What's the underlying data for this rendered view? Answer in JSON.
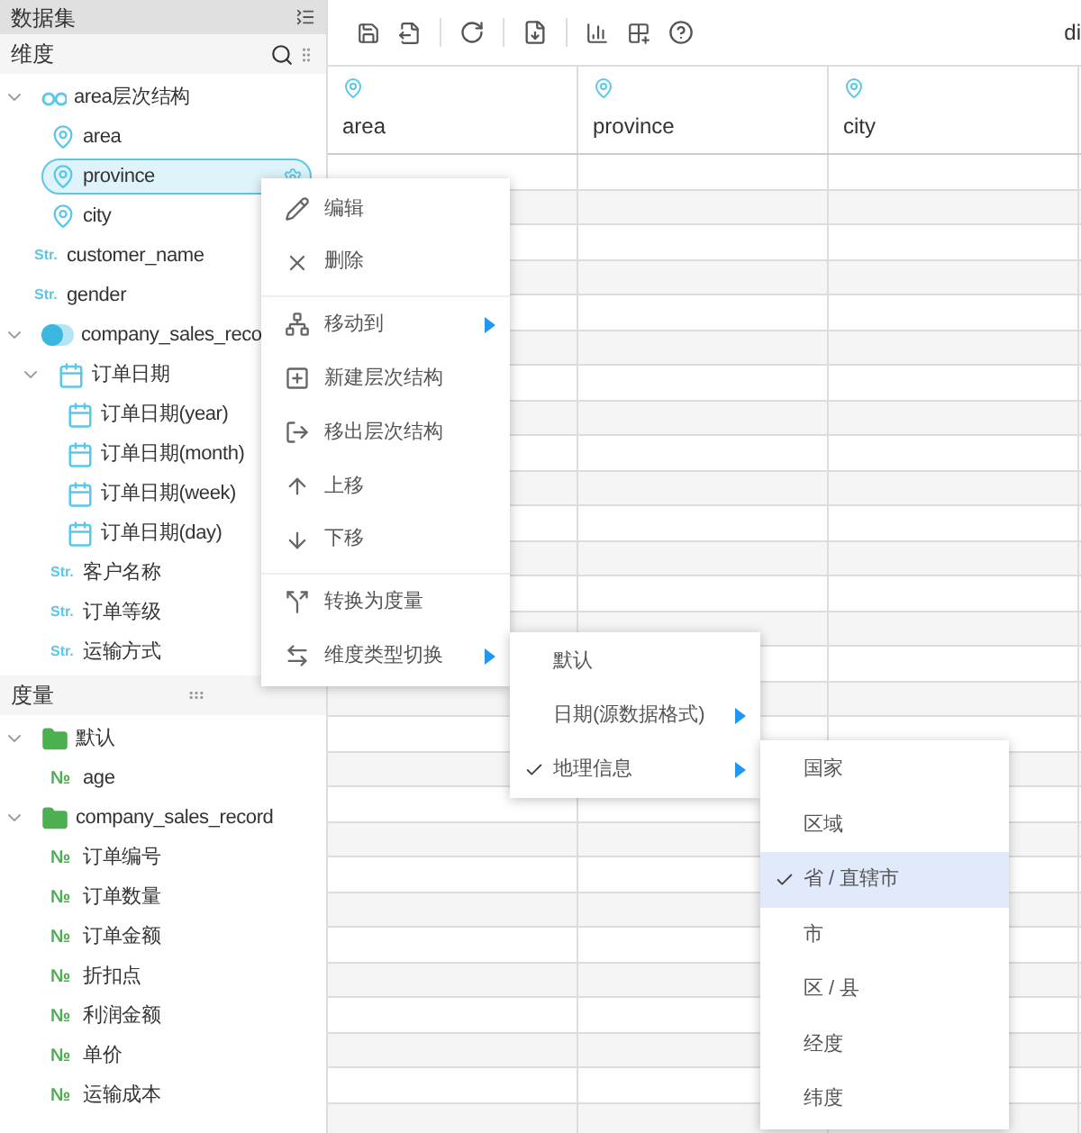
{
  "panel_title": "数据集",
  "dimensions": {
    "title": "维度",
    "items": [
      {
        "kind": "hierarchy",
        "label": "area层次结构",
        "selected": false,
        "expanded": true,
        "children": [
          {
            "kind": "geo",
            "label": "area",
            "selected": false
          },
          {
            "kind": "geo",
            "label": "province",
            "selected": true
          },
          {
            "kind": "geo",
            "label": "city",
            "selected": false
          }
        ]
      },
      {
        "kind": "text",
        "type_label": "Str.",
        "label": "customer_name",
        "selected": false
      },
      {
        "kind": "text",
        "type_label": "Str.",
        "label": "gender",
        "selected": false
      },
      {
        "kind": "dataset",
        "label": "company_sales_reco",
        "selected": false,
        "expanded": true,
        "children": [
          {
            "kind": "date",
            "label": "订单日期",
            "selected": false,
            "expanded": true,
            "children": [
              {
                "kind": "date",
                "label": "订单日期(year)",
                "selected": false
              },
              {
                "kind": "date",
                "label": "订单日期(month)",
                "selected": false
              },
              {
                "kind": "date",
                "label": "订单日期(week)",
                "selected": false
              },
              {
                "kind": "date",
                "label": "订单日期(day)",
                "selected": false
              }
            ]
          },
          {
            "kind": "text",
            "type_label": "Str.",
            "label": "客户名称",
            "selected": false
          },
          {
            "kind": "text",
            "type_label": "Str.",
            "label": "订单等级",
            "selected": false
          },
          {
            "kind": "text",
            "type_label": "Str.",
            "label": "运输方式",
            "selected": false
          }
        ]
      }
    ]
  },
  "measures": {
    "title": "度量",
    "items": [
      {
        "kind": "folder",
        "label": "默认",
        "selected": false,
        "expanded": true,
        "children": [
          {
            "kind": "number",
            "type_label": "№",
            "label": "age",
            "selected": false
          }
        ]
      },
      {
        "kind": "folder",
        "label": "company_sales_record",
        "selected": false,
        "expanded": true,
        "children": [
          {
            "kind": "number",
            "type_label": "№",
            "label": "订单编号",
            "selected": false
          },
          {
            "kind": "number",
            "type_label": "№",
            "label": "订单数量",
            "selected": false
          },
          {
            "kind": "number",
            "type_label": "№",
            "label": "订单金额",
            "selected": false
          },
          {
            "kind": "number",
            "type_label": "№",
            "label": "折扣点",
            "selected": false
          },
          {
            "kind": "number",
            "type_label": "№",
            "label": "利润金额",
            "selected": false
          },
          {
            "kind": "number",
            "type_label": "№",
            "label": "单价",
            "selected": false
          },
          {
            "kind": "number",
            "type_label": "№",
            "label": "运输成本",
            "selected": false
          }
        ]
      }
    ]
  },
  "toolbar_label": "di",
  "table": {
    "columns": [
      {
        "kind": "geo",
        "label": "area"
      },
      {
        "kind": "geo",
        "label": "province"
      },
      {
        "kind": "geo",
        "label": "city"
      }
    ]
  },
  "context_menu": [
    {
      "kind": "edit",
      "label": "编辑",
      "has_submenu": false,
      "divider_after": false
    },
    {
      "kind": "delete",
      "label": "删除",
      "has_submenu": false,
      "divider_after": true
    },
    {
      "kind": "move",
      "label": "移动到",
      "has_submenu": true,
      "divider_after": false
    },
    {
      "kind": "new",
      "label": "新建层次结构",
      "has_submenu": false,
      "divider_after": false
    },
    {
      "kind": "exit",
      "label": "移出层次结构",
      "has_submenu": false,
      "divider_after": false
    },
    {
      "kind": "up",
      "label": "上移",
      "has_submenu": false,
      "divider_after": false
    },
    {
      "kind": "down",
      "label": "下移",
      "has_submenu": false,
      "divider_after": true
    },
    {
      "kind": "convert",
      "label": "转换为度量",
      "has_submenu": false,
      "divider_after": false
    },
    {
      "kind": "switch",
      "label": "维度类型切换",
      "has_submenu": true,
      "divider_after": false
    }
  ],
  "type_menu": [
    {
      "label": "默认",
      "checked": false,
      "has_submenu": false
    },
    {
      "label": "日期(源数据格式)",
      "checked": false,
      "has_submenu": true
    },
    {
      "label": "地理信息",
      "checked": true,
      "has_submenu": true
    }
  ],
  "geo_menu": [
    {
      "label": "国家",
      "checked": false,
      "selected": false
    },
    {
      "label": "区域",
      "checked": false,
      "selected": false
    },
    {
      "label": "省 / 直辖市",
      "checked": true,
      "selected": true
    },
    {
      "label": "市",
      "checked": false,
      "selected": false
    },
    {
      "label": "区 / 县",
      "checked": false,
      "selected": false
    },
    {
      "label": "经度",
      "checked": false,
      "selected": false
    },
    {
      "label": "纬度",
      "checked": false,
      "selected": false
    }
  ]
}
